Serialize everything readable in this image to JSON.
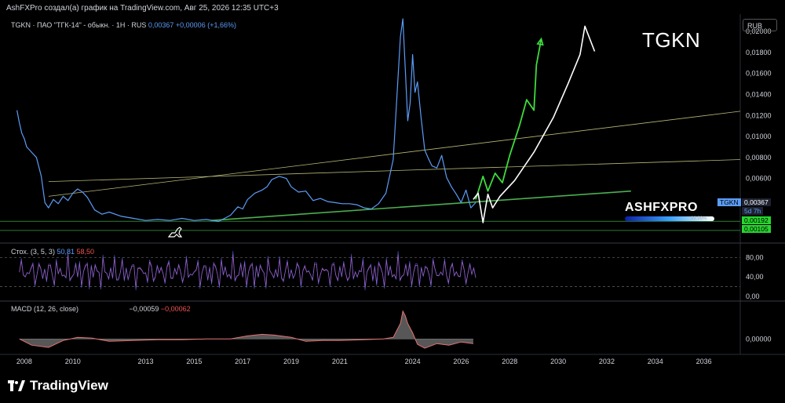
{
  "header": {
    "attribution": "AshFXPro создал(а) график на TradingView.com, Авг 25, 2026 12:35 UTC+3",
    "symbol_desc": "TGKN · ПАО \"ТГК-14\" - обыкн. · 1H · RUS",
    "last_price": "0,00367",
    "change": "+0,00006 (+1,66%)",
    "big_ticker": "TGKN",
    "currency": "RUB"
  },
  "price_tags": {
    "last": "0,00367",
    "countdown": "5d 7h",
    "ticker_tag": "TGKN",
    "support1": "0,00192",
    "support2": "0,00105"
  },
  "watermark": {
    "text": "ASHFXPRO",
    "percent": "99.99%"
  },
  "indicators": {
    "stoch_name": "Стох. (3, 5, 3)",
    "stoch_k": "50,81",
    "stoch_d": "58,50",
    "macd_name": "MACD (12, 26, close)",
    "macd_val": "−0,00059",
    "macd_signal": "−0,00062"
  },
  "branding": {
    "logo_text": "TradingView"
  },
  "colors": {
    "price_line": "#5b9cf6",
    "support_green": "#2e7d32",
    "trend_green": "#4caf50",
    "forecast_green": "#3ddc3d",
    "forecast_white": "#ffffff",
    "trend_yellow": "#b8b878",
    "stoch": "#c94fa0",
    "stoch_k": "#5b6ef0",
    "macd_area": "#e57373"
  },
  "chart_data": {
    "type": "line",
    "price_axis": {
      "ticks": [
        "0,02000",
        "0,01800",
        "0,01600",
        "0,01400",
        "0,01200",
        "0,01000",
        "0,00800",
        "0,00600"
      ],
      "values": [
        0.02,
        0.018,
        0.016,
        0.014,
        0.012,
        0.01,
        0.008,
        0.006
      ],
      "ylim": [
        0.0,
        0.0215
      ]
    },
    "stoch_axis": {
      "ticks": [
        "80,00",
        "40,00",
        "0,00"
      ],
      "values": [
        80,
        40,
        0
      ],
      "ylim": [
        -10,
        100
      ]
    },
    "macd_axis": {
      "ticks": [
        "0,00000"
      ],
      "values": [
        0
      ]
    },
    "time_axis": {
      "ticks": [
        "2008",
        "2010",
        "2013",
        "2015",
        "2017",
        "2019",
        "2021",
        "2024",
        "2026",
        "2028",
        "2030",
        "2032",
        "2034",
        "2036"
      ],
      "values": [
        2008,
        2010,
        2013,
        2015,
        2017,
        2019,
        2021,
        2024,
        2026,
        2028,
        2030,
        2032,
        2034,
        2036
      ],
      "xlim": [
        2007,
        2037.5
      ]
    },
    "series": [
      {
        "x": [
          2007.7,
          2007.8,
          2007.9,
          2008.0,
          2008.1,
          2008.3,
          2008.5,
          2008.7,
          2008.85,
          2009.0,
          2009.2,
          2009.4,
          2009.6,
          2009.8,
          2010.0,
          2010.2,
          2010.4,
          2010.6,
          2010.9,
          2011.2,
          2011.5,
          2012.0,
          2012.5,
          2013.0,
          2013.5,
          2014.0,
          2014.5,
          2015.0,
          2015.5,
          2016.0,
          2016.5,
          2016.8,
          2017.0,
          2017.2,
          2017.5,
          2017.8,
          2018.0,
          2018.2,
          2018.5,
          2018.8,
          2019.0,
          2019.3,
          2019.6,
          2019.9,
          2020.2,
          2020.5,
          2020.8,
          2021.1,
          2021.4,
          2021.7,
          2022.0,
          2022.3,
          2022.6,
          2022.9,
          2023.2,
          2023.5,
          2023.6,
          2023.7,
          2023.8,
          2023.9,
          2024.0,
          2024.1,
          2024.2,
          2024.35,
          2024.5,
          2024.65,
          2024.8,
          2025.0,
          2025.2,
          2025.4,
          2025.6,
          2025.8,
          2026.0,
          2026.2,
          2026.4,
          2026.6
        ],
        "y": [
          0.0125,
          0.0113,
          0.0103,
          0.0098,
          0.009,
          0.0085,
          0.008,
          0.0062,
          0.0037,
          0.0032,
          0.004,
          0.0036,
          0.0043,
          0.0039,
          0.0046,
          0.005,
          0.0047,
          0.0042,
          0.003,
          0.0026,
          0.0028,
          0.0024,
          0.0022,
          0.002,
          0.0021,
          0.002,
          0.0022,
          0.002,
          0.0021,
          0.0019,
          0.0025,
          0.0033,
          0.0031,
          0.004,
          0.0046,
          0.0049,
          0.0052,
          0.0059,
          0.0062,
          0.006,
          0.0052,
          0.0047,
          0.0048,
          0.0039,
          0.0041,
          0.0038,
          0.0037,
          0.0036,
          0.0036,
          0.0035,
          0.0032,
          0.0031,
          0.0036,
          0.0046,
          0.0078,
          0.0195,
          0.0212,
          0.0164,
          0.0115,
          0.0132,
          0.0178,
          0.0142,
          0.0152,
          0.0118,
          0.0087,
          0.0079,
          0.0072,
          0.007,
          0.0082,
          0.0061,
          0.0052,
          0.0045,
          0.0037,
          0.0049,
          0.0032,
          0.0037
        ]
      }
    ],
    "forecast_green": {
      "x": [
        2026.6,
        2026.9,
        2027.1,
        2027.4,
        2027.7,
        2028.0,
        2028.4,
        2028.7,
        2029.0,
        2029.1,
        2029.3
      ],
      "y": [
        0.004,
        0.0062,
        0.0048,
        0.0065,
        0.0056,
        0.0082,
        0.011,
        0.0135,
        0.0125,
        0.0168,
        0.0193
      ]
    },
    "forecast_white": {
      "x": [
        2026.5,
        2026.7,
        2026.9,
        2027.1,
        2027.3,
        2027.6,
        2028.2,
        2029.0,
        2029.8,
        2030.4,
        2030.9,
        2031.1,
        2031.5
      ],
      "y": [
        0.004,
        0.0046,
        0.0018,
        0.0045,
        0.0032,
        0.0043,
        0.0058,
        0.0085,
        0.0118,
        0.015,
        0.0178,
        0.0205,
        0.0181
      ]
    },
    "trend_green": {
      "x": [
        2015.7,
        2033.0
      ],
      "y": [
        0.002,
        0.0048
      ]
    },
    "trend_yellow_1": {
      "x": [
        2009.0,
        2037.5
      ],
      "y": [
        0.0043,
        0.0124
      ]
    },
    "trend_yellow_2": {
      "x": [
        2009.0,
        2037.5
      ],
      "y": [
        0.0057,
        0.0078
      ]
    },
    "support_levels": [
      0.00192,
      0.00105
    ],
    "stoch_levels": [
      80,
      20
    ],
    "macd_x": [
      2007.8,
      2008.3,
      2009.0,
      2009.6,
      2010.2,
      2010.8,
      2011.5,
      2012.5,
      2013.5,
      2014.5,
      2015.5,
      2016.5,
      2017.2,
      2017.8,
      2018.3,
      2019.0,
      2019.6,
      2020.3,
      2021.0,
      2022.0,
      2022.8,
      2023.2,
      2023.5,
      2023.6,
      2023.7,
      2023.8,
      2024.0,
      2024.2,
      2024.5,
      2025.0,
      2025.5,
      2026.0,
      2026.5
    ],
    "macd_y": [
      0.0,
      -0.0008,
      -0.0011,
      -0.0002,
      0.0002,
      0.0001,
      -0.0003,
      -0.0002,
      -0.0001,
      -0.0001,
      0.0,
      0.0,
      0.0004,
      0.0006,
      0.0005,
      0.0002,
      -0.0003,
      -0.0002,
      -0.0002,
      -0.0001,
      0.0,
      0.0002,
      0.002,
      0.0036,
      0.003,
      0.002,
      0.0008,
      -0.0007,
      -0.0012,
      -0.0006,
      -0.0008,
      -0.0004,
      -0.0006
    ],
    "macd_ylim": [
      -0.002,
      0.0045
    ]
  }
}
